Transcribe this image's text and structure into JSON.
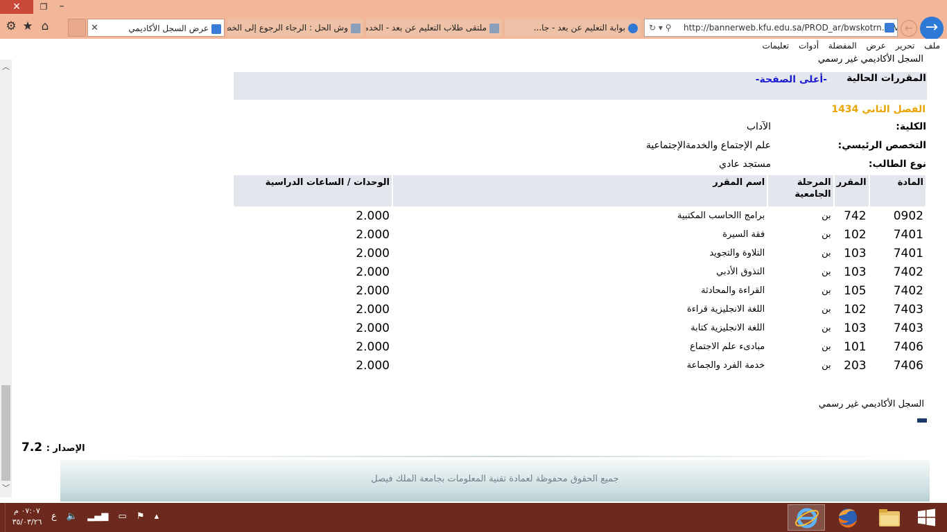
{
  "browser": {
    "active_tab_title": "عرض السجل الأكاديمي",
    "tabs": [
      "وش الحل : الرجاء الرجوع إلى الخط...",
      "ملتقى طلاب التعليم عن بعد - الخدمات ال...",
      "بوابة التعليم عن بعد - جا..."
    ],
    "url": "http://bannerweb.kfu.edu.sa/PROD_ar/bwskotrn.P_Vie",
    "menu": [
      "ملف",
      "تحرير",
      "عرض",
      "المفضلة",
      "أدوات",
      "تعليمات"
    ]
  },
  "page": {
    "top_title": "السجل الأكاديمي غير رسمي",
    "current_courses_heading": "المقررات الحالية",
    "top_link": "-أعلى الصفحة-",
    "term": "الفصل الثاني 1434",
    "info": [
      {
        "label": "الكلية:",
        "value": "الآداب"
      },
      {
        "label": "التخصص الرئيسي:",
        "value": "علم الإجتماع والخدمةالإجتماعية"
      },
      {
        "label": "نوع الطالب:",
        "value": "مستجد عادي"
      }
    ],
    "table_headers": [
      "المادة",
      "المقرر",
      "المرحلة الجامعية",
      "اسم المقرر",
      "الوحدات / الساعات الدراسية"
    ],
    "courses": [
      {
        "subject": "0902",
        "course": "742",
        "level": "بن",
        "title": "برامج االحاسب المكتبية",
        "units": "2.000"
      },
      {
        "subject": "7401",
        "course": "102",
        "level": "بن",
        "title": "فقة السيرة",
        "units": "2.000"
      },
      {
        "subject": "7401",
        "course": "103",
        "level": "بن",
        "title": "التلاوة والتجويد",
        "units": "2.000"
      },
      {
        "subject": "7402",
        "course": "103",
        "level": "بن",
        "title": "التذوق الأدبي",
        "units": "2.000"
      },
      {
        "subject": "7402",
        "course": "105",
        "level": "بن",
        "title": "القراءة والمحادثة",
        "units": "2.000"
      },
      {
        "subject": "7403",
        "course": "102",
        "level": "بن",
        "title": "اللغة الانجليزية قراءة",
        "units": "2.000"
      },
      {
        "subject": "7403",
        "course": "103",
        "level": "بن",
        "title": "اللغة الانجليزية كتابة",
        "units": "2.000"
      },
      {
        "subject": "7406",
        "course": "101",
        "level": "بن",
        "title": "مبادىء علم الاجتماع",
        "units": "2.000"
      },
      {
        "subject": "7406",
        "course": "203",
        "level": "بن",
        "title": "خدمة الفرد والجماعة",
        "units": "2.000"
      }
    ],
    "bottom_title": "السجل الأكاديمي غير رسمي",
    "version_label": "الإصدار :",
    "version_number": "7.2",
    "footer": "جميع الحقوق محفوظة لعمادة تقنية المعلومات بجامعة الملك فيصل"
  },
  "taskbar": {
    "time": "٠٧:٠٧ م",
    "date": "٣٥/٠٣/٢٦",
    "lang": "ع"
  },
  "colors": {
    "chrome": "#f1b798",
    "header_band": "#e4e6ee",
    "link": "#1b1bd0",
    "term": "#e8a400",
    "taskbar": "#6b2a1d"
  }
}
